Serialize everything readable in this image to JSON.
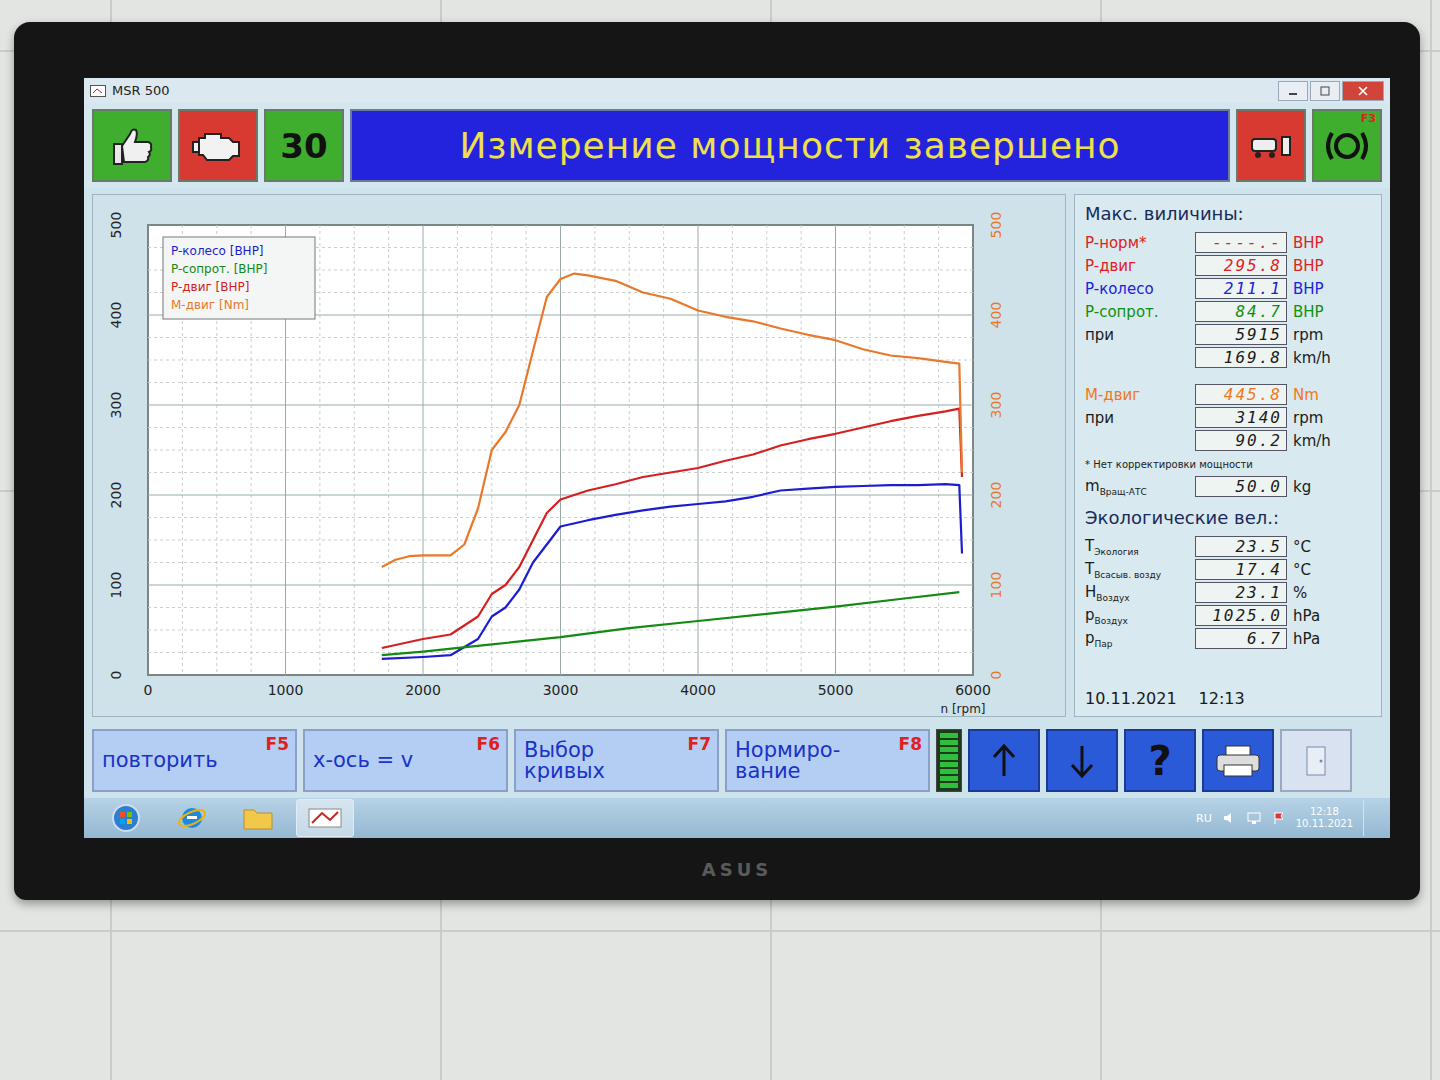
{
  "window": {
    "title": "MSR 500"
  },
  "toolbar": {
    "code": "30",
    "banner": "Измерение мощности завершено",
    "key": "F3"
  },
  "chart": {
    "y_ticks_left": [
      "0",
      "100",
      "200",
      "300",
      "400",
      "500"
    ],
    "y_ticks_right": [
      "0",
      "100",
      "200",
      "300",
      "400",
      "500"
    ],
    "x_ticks": [
      "0",
      "1000",
      "2000",
      "3000",
      "4000",
      "5000",
      "6000"
    ],
    "x_label": "n [rpm]",
    "series": [
      {
        "label": "P-колесо [BHP]",
        "color": "#1c1cd0",
        "rpm": [
          1700,
          2000,
          2200,
          2400,
          2500,
          2600,
          2700,
          2800,
          2900,
          3000,
          3200,
          3400,
          3600,
          3800,
          4000,
          4200,
          4400,
          4600,
          4800,
          5000,
          5200,
          5400,
          5600,
          5800,
          5900,
          5920
        ],
        "values": [
          18,
          20,
          22,
          40,
          65,
          75,
          95,
          125,
          145,
          165,
          172,
          178,
          183,
          187,
          190,
          193,
          198,
          205,
          207,
          209,
          210,
          211,
          211,
          212,
          211,
          135
        ]
      },
      {
        "label": "P-сопрот. [BHP]",
        "color": "#138a13",
        "rpm": [
          1700,
          2000,
          2500,
          3000,
          3500,
          4000,
          4500,
          5000,
          5500,
          5900
        ],
        "values": [
          22,
          26,
          34,
          42,
          52,
          60,
          68,
          76,
          85,
          92
        ]
      },
      {
        "label": "P-двиг [BHP]",
        "color": "#d42020",
        "rpm": [
          1700,
          2000,
          2200,
          2400,
          2500,
          2600,
          2700,
          2800,
          2900,
          3000,
          3200,
          3400,
          3600,
          3800,
          4000,
          4200,
          4400,
          4600,
          4800,
          5000,
          5200,
          5400,
          5600,
          5800,
          5900,
          5920
        ],
        "values": [
          30,
          40,
          45,
          65,
          90,
          100,
          120,
          150,
          180,
          195,
          205,
          212,
          220,
          225,
          230,
          238,
          245,
          255,
          262,
          268,
          275,
          282,
          288,
          293,
          296,
          220
        ]
      },
      {
        "label": "M-двиг [Nm]",
        "color": "#e8782a",
        "rpm": [
          1700,
          1800,
          1900,
          2000,
          2200,
          2300,
          2400,
          2500,
          2600,
          2700,
          2800,
          2900,
          3000,
          3100,
          3200,
          3400,
          3600,
          3800,
          4000,
          4200,
          4400,
          4600,
          4800,
          5000,
          5200,
          5400,
          5600,
          5800,
          5900,
          5920
        ],
        "values": [
          120,
          128,
          132,
          133,
          133,
          145,
          185,
          250,
          270,
          300,
          360,
          420,
          440,
          446,
          444,
          438,
          425,
          418,
          405,
          398,
          393,
          385,
          378,
          372,
          362,
          355,
          352,
          348,
          346,
          225
        ]
      }
    ]
  },
  "max_panel": {
    "title": "Макс. виличины:",
    "power_rows": [
      {
        "label": "P-норм*",
        "value": "----.-",
        "unit": "BHP",
        "color": "#e02020"
      },
      {
        "label": "P-двиг",
        "value": "295.8",
        "unit": "BHP",
        "color": "#e02020"
      },
      {
        "label": "P-колесо",
        "value": "211.1",
        "unit": "BHP",
        "color": "#2020e0"
      },
      {
        "label": "P-сопрот.",
        "value": "84.7",
        "unit": "BHP",
        "color": "#109010"
      },
      {
        "label": "при",
        "value": "5915",
        "unit": "rpm",
        "color": "#1a1a1a"
      },
      {
        "label": "",
        "value": "169.8",
        "unit": "km/h",
        "color": "#1a1a1a"
      }
    ],
    "torque_rows": [
      {
        "label": "M-двиг",
        "value": "445.8",
        "unit": "Nm",
        "color": "#f07820"
      },
      {
        "label": "при",
        "value": "3140",
        "unit": "rpm",
        "color": "#1a1a1a"
      },
      {
        "label": "",
        "value": "90.2",
        "unit": "km/h",
        "color": "#1a1a1a"
      }
    ],
    "note": "* Нет корректировки мощности",
    "mass": {
      "label": "m",
      "sub": "Вращ-АТС",
      "value": "50.0",
      "unit": "kg"
    }
  },
  "eco_panel": {
    "title": "Экологические вел.:",
    "rows": [
      {
        "label": "T",
        "sub": "Экология",
        "value": "23.5",
        "unit": "°C"
      },
      {
        "label": "T",
        "sub": "Всасыв. возду",
        "value": "17.4",
        "unit": "°C"
      },
      {
        "label": "H",
        "sub": "Воздух",
        "value": "23.1",
        "unit": "%"
      },
      {
        "label": "p",
        "sub": "Воздух",
        "value": "1025.0",
        "unit": "hPa"
      },
      {
        "label": "p",
        "sub": "Пар",
        "value": "6.7",
        "unit": "hPa"
      }
    ]
  },
  "timestamp": {
    "date": "10.11.2021",
    "time": "12:13"
  },
  "function_keys": [
    {
      "label": "повторить",
      "key": "F5"
    },
    {
      "label": "x-ось = v",
      "key": "F6"
    },
    {
      "label": "Выбор кривых",
      "key": "F7"
    },
    {
      "label": "Нормиро-вание",
      "key": "F8"
    }
  ],
  "meter": {
    "level": 1
  },
  "help": "?",
  "taskbar": {
    "lang": "RU",
    "time": "12:18",
    "date": "10.11.2021"
  },
  "monitor": {
    "brand": "ASUS"
  }
}
